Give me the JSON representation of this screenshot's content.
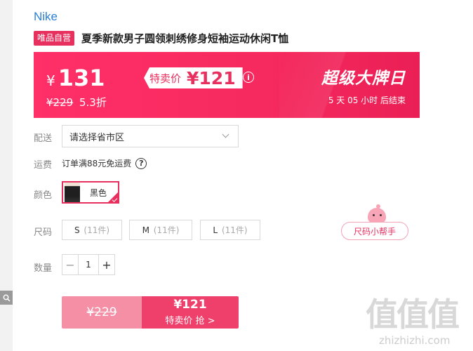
{
  "brand": "Nike",
  "badge": "唯品自营",
  "title": "夏季新款男子圆领刺绣修身短袖运动休闲T恤",
  "price": {
    "currency_symbol": "¥",
    "current": "131",
    "sale_label": "特卖价",
    "sale_price": "¥121",
    "original": "¥229",
    "discount": "5.3折",
    "info_glyph": "i"
  },
  "promo": {
    "title": "超级大牌日",
    "countdown": "5  天 05 小时 后结束"
  },
  "delivery": {
    "label": "配送",
    "placeholder": "请选择省市区"
  },
  "shipping": {
    "label": "运费",
    "text": "订单满88元免运费",
    "help_glyph": "?"
  },
  "color": {
    "label": "颜色",
    "selected": "黑色"
  },
  "size": {
    "label": "尺码",
    "options": [
      {
        "name": "S",
        "count": "(11件)"
      },
      {
        "name": "M",
        "count": "(11件)"
      },
      {
        "name": "L",
        "count": "(11件)"
      }
    ],
    "helper": "尺码小帮手"
  },
  "quantity": {
    "label": "数量",
    "minus": "−",
    "value": "1",
    "plus": "+"
  },
  "buy": {
    "original": "¥229",
    "price": "¥121",
    "label": "特卖价 抢 >"
  },
  "watermark": {
    "logo": "值值值",
    "url": "zhizhizhi.com"
  },
  "colors": {
    "accent": "#e8305f",
    "banner": "#ff2f68",
    "link": "#2a7fd4"
  }
}
